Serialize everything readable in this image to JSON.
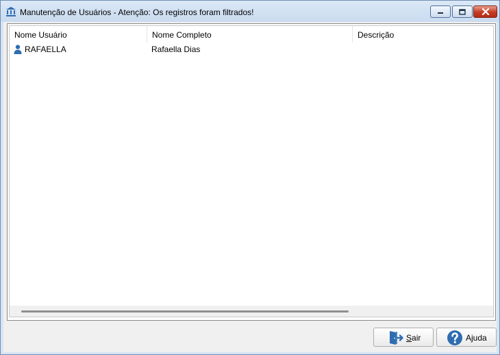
{
  "window": {
    "title": "Manutenção de Usuários - Atenção: Os registros foram filtrados!",
    "icons": [
      "bank-icon",
      "minimize-icon",
      "maximize-icon",
      "close-icon"
    ]
  },
  "list": {
    "columns": [
      "Nome Usuário",
      "Nome Completo",
      "Descrição"
    ],
    "rows": [
      {
        "icon": "user-icon",
        "nome_usuario": "RAFAELLA",
        "nome_completo": "Rafaella Dias",
        "descricao": ""
      }
    ]
  },
  "buttons": {
    "sair": {
      "accel": "S",
      "rest": "air",
      "icon": "exit-door-icon"
    },
    "ajuda": {
      "label": "Ajuda",
      "icon": "help-icon"
    }
  },
  "colors": {
    "frame": "#d6e4f3",
    "client": "#f0f0f0",
    "accent_blue": "#2f6db0",
    "close_red": "#c43b24"
  }
}
